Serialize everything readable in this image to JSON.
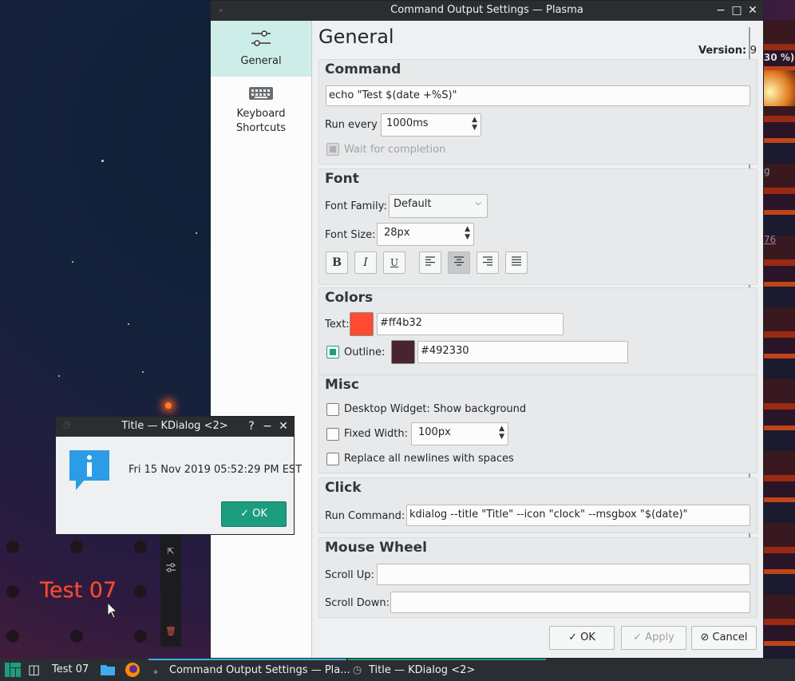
{
  "desktop": {
    "right_strip_texts": [
      "30 %)",
      "g",
      "76"
    ],
    "widget_text": "Test 07",
    "widget_colors": {
      "text": "#ff4b32",
      "outline": "#492330"
    }
  },
  "main_window": {
    "title": "Command Output Settings — Plasma",
    "sidebar": {
      "items": [
        {
          "label": "General",
          "icon": "sliders-icon"
        },
        {
          "label": "Keyboard Shortcuts",
          "icon": "keyboard-icon"
        }
      ]
    },
    "page_title": "General",
    "version_label": "Version:",
    "version_value": "9",
    "command": {
      "title": "Command",
      "value": "echo \"Test $(date +%S)\"",
      "run_every_label": "Run every",
      "run_every_value": "1000ms",
      "wait_label": "Wait for completion"
    },
    "font": {
      "title": "Font",
      "family_label": "Font Family:",
      "family_value": "Default",
      "size_label": "Font Size:",
      "size_value": "28px",
      "bold": "B",
      "italic": "I",
      "underline": "U"
    },
    "colors": {
      "title": "Colors",
      "text_label": "Text:",
      "text_value": "#ff4b32",
      "outline_label": "Outline:",
      "outline_value": "#492330"
    },
    "misc": {
      "title": "Misc",
      "show_bg_label": "Desktop Widget: Show background",
      "fixed_width_label": "Fixed Width:",
      "fixed_width_value": "100px",
      "newlines_label": "Replace all newlines with spaces"
    },
    "click": {
      "title": "Click",
      "run_label": "Run Command:",
      "run_value": "kdialog --title \"Title\" --icon \"clock\" --msgbox \"$(date)\""
    },
    "mouse_wheel": {
      "title": "Mouse Wheel",
      "up_label": "Scroll Up:",
      "up_value": "",
      "down_label": "Scroll Down:",
      "down_value": ""
    },
    "buttons": {
      "ok": "OK",
      "apply": "Apply",
      "cancel": "Cancel"
    }
  },
  "kdialog": {
    "title": "Title — KDialog <2>",
    "help": "?",
    "message": "Fri 15 Nov 2019 05:52:29 PM EST",
    "ok": "OK"
  },
  "taskbar": {
    "pager_label": "Test 07",
    "tasks": [
      {
        "label": "Command Output Settings — Pla..."
      },
      {
        "label": "Title — KDialog <2>"
      }
    ]
  }
}
